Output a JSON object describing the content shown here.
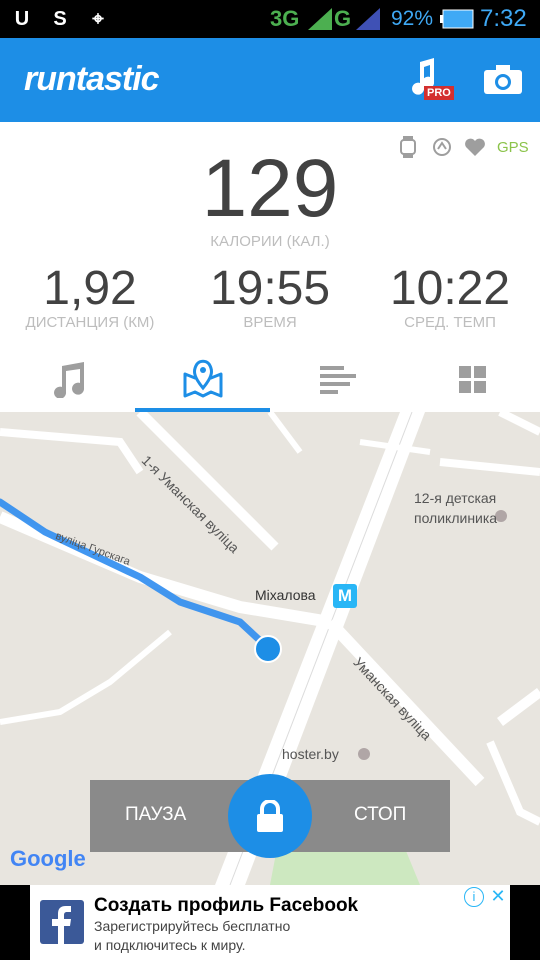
{
  "status_bar": {
    "network_type": "3G",
    "network_secondary": "G",
    "battery_percent": "92%",
    "time": "7:32"
  },
  "app_bar": {
    "logo": "runtastic",
    "pro_badge": "PRO"
  },
  "stats": {
    "gps_label": "GPS",
    "calories_value": "129",
    "calories_label": "КАЛОРИИ (КАЛ.)",
    "distance_value": "1,92",
    "distance_label": "ДИСТАНЦИЯ (КМ)",
    "time_value": "19:55",
    "time_label": "ВРЕМЯ",
    "pace_value": "10:22",
    "pace_label": "СРЕД. ТЕМП"
  },
  "tabs": [
    {
      "icon": "music-icon"
    },
    {
      "icon": "map-icon",
      "active": true
    },
    {
      "icon": "list-icon"
    },
    {
      "icon": "grid-icon"
    }
  ],
  "map": {
    "street_1": "1-я Уманская вуліца",
    "street_2": "вуліца Гурскага",
    "street_3": "Уманская вуліца",
    "metro_station": "Міхалова",
    "metro_badge": "M",
    "poi_clinic": "12-я детская поликлиника",
    "poi_hoster": "hoster.by",
    "google_logo": "Google"
  },
  "controls": {
    "pause_label": "ПАУЗА",
    "stop_label": "СТОП"
  },
  "ad": {
    "title": "Создать профиль Facebook",
    "line1": "Зарегистрируйтесь бесплатно",
    "line2": "и подключитесь к миру."
  },
  "colors": {
    "accent": "#1d8ee6",
    "gps": "#8bc34a",
    "stat_text": "#424242",
    "label_text": "#bdbdbd"
  }
}
